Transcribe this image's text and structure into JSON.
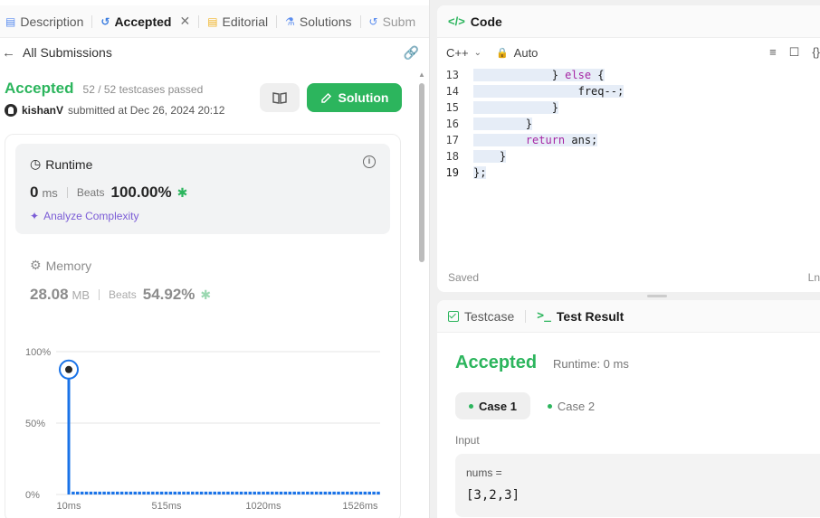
{
  "tabs": [
    {
      "label": "Description",
      "icon": "description-icon"
    },
    {
      "label": "Accepted",
      "icon": "history-icon"
    },
    {
      "label": "Editorial",
      "icon": "book-icon"
    },
    {
      "label": "Solutions",
      "icon": "flask-icon"
    },
    {
      "label": "Subm",
      "icon": "history-icon"
    }
  ],
  "subheader": {
    "back_label": "All Submissions"
  },
  "submission": {
    "status": "Accepted",
    "testcases": "52 / 52 testcases passed",
    "user": "kishanV",
    "submitted_at": "submitted at Dec 26, 2024 20:12",
    "solution_button": "Solution"
  },
  "runtime": {
    "title": "Runtime",
    "value": "0",
    "unit": "ms",
    "beats_label": "Beats",
    "beats_value": "100.00%",
    "analyze_label": "Analyze Complexity"
  },
  "memory": {
    "title": "Memory",
    "value": "28.08",
    "unit": "MB",
    "beats_label": "Beats",
    "beats_value": "54.92%"
  },
  "chart_data": {
    "type": "bar",
    "ytick_labels": [
      "100%",
      "50%",
      "0%"
    ],
    "xtick_labels": [
      "10ms",
      "515ms",
      "1020ms",
      "1526ms"
    ],
    "ylim": [
      0,
      100
    ],
    "grid": true,
    "highlighted_value": 90,
    "bar_count": 71,
    "values_note_free": true,
    "values": [
      90,
      2,
      2,
      2,
      2,
      2,
      2,
      2,
      2,
      2,
      2,
      2,
      2,
      2,
      2,
      2,
      2,
      2,
      2,
      2,
      2,
      2,
      2,
      2,
      2,
      2,
      2,
      2,
      2,
      2,
      2,
      2,
      2,
      2,
      2,
      2,
      2,
      2,
      2,
      2,
      2,
      2,
      2,
      2,
      2,
      2,
      2,
      2,
      2,
      2,
      2,
      2,
      2,
      2,
      2,
      2,
      2,
      2,
      2,
      2,
      2,
      2,
      2,
      2,
      2,
      2,
      2,
      2,
      2,
      2,
      2
    ],
    "colors": {
      "bar": "#1a73e8",
      "grid": "#e6e6e6"
    }
  },
  "code": {
    "title": "Code",
    "language": "C++",
    "mode": "Auto",
    "saved": "Saved",
    "ln_indicator": "Ln",
    "lines": [
      {
        "num": "13",
        "pre": "            } ",
        "kw": "else",
        "post": " {"
      },
      {
        "num": "14",
        "pre": "                freq--;",
        "kw": "",
        "post": ""
      },
      {
        "num": "15",
        "pre": "            }",
        "kw": "",
        "post": ""
      },
      {
        "num": "16",
        "pre": "        }",
        "kw": "",
        "post": ""
      },
      {
        "num": "17",
        "pre": "        ",
        "kw": "return",
        "post": " ans;"
      },
      {
        "num": "18",
        "pre": "    }",
        "kw": "",
        "post": ""
      },
      {
        "num": "19",
        "pre": "};",
        "kw": "",
        "post": ""
      }
    ]
  },
  "testpanel": {
    "tab1": "Testcase",
    "tab2": "Test Result",
    "result": "Accepted",
    "runtime": "Runtime: 0 ms",
    "cases": [
      "Case 1",
      "Case 2"
    ],
    "input_label": "Input",
    "var_name": "nums =",
    "var_value": "[3,2,3]"
  },
  "colors": {
    "accent_green": "#2cb55d",
    "purple": "#7b5cd6"
  }
}
